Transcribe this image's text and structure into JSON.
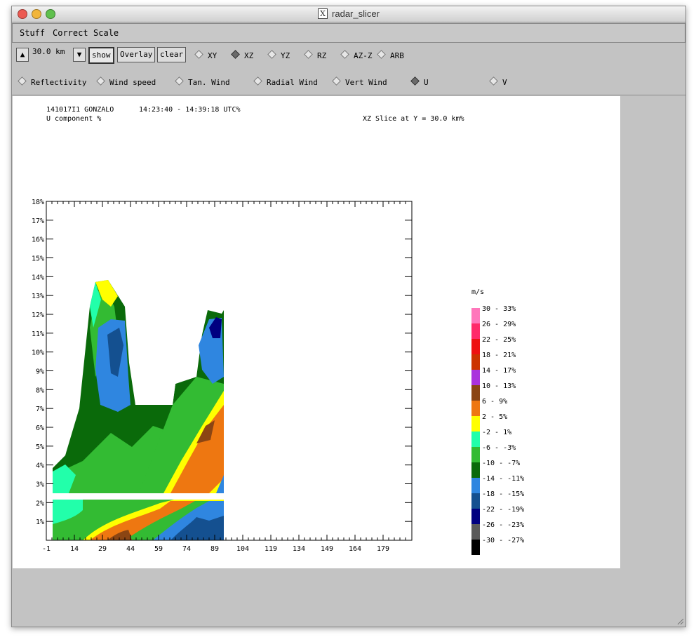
{
  "window": {
    "title": "radar_slicer"
  },
  "menu": [
    "Stuff",
    "Correct",
    "Scale"
  ],
  "toolbar": {
    "distance": "30.0 km",
    "show_label": "show",
    "overlay_label": "Overlay",
    "clear_label": "clear",
    "slice_options": [
      "XY",
      "XZ",
      "YZ",
      "RZ",
      "AZ-Z",
      "ARB"
    ],
    "selected_slice": "XZ"
  },
  "fields": {
    "options": [
      "Reflectivity",
      "Wind speed",
      "Tan. Wind",
      "Radial Wind",
      "Vert Wind",
      "U",
      "V"
    ],
    "selected": "U"
  },
  "plot": {
    "header_id": "141017I1 GONZALO",
    "header_time": "14:23:40 - 14:39:18 UTC%",
    "header_field": "U component %",
    "header_slice": "XZ Slice at Y = 30.0 km%",
    "x_ticks": [
      "-1",
      "14",
      "29",
      "44",
      "59",
      "74",
      "89",
      "104",
      "119",
      "134",
      "149",
      "164",
      "179"
    ],
    "y_ticks": [
      "1%",
      "2%",
      "3%",
      "4%",
      "5%",
      "6%",
      "7%",
      "8%",
      "9%",
      "10%",
      "11%",
      "12%",
      "13%",
      "14%",
      "15%",
      "16%",
      "17%",
      "18%"
    ],
    "legend_unit": "m/s",
    "legend": [
      {
        "label": "30 - 33%",
        "color": "#ff77bb"
      },
      {
        "label": "26 - 29%",
        "color": "#ff2a6a"
      },
      {
        "label": "22 - 25%",
        "color": "#ee1111"
      },
      {
        "label": "18 - 21%",
        "color": "#cc3300"
      },
      {
        "label": "14 - 17%",
        "color": "#aa33dd"
      },
      {
        "label": "10 - 13%",
        "color": "#8b4513"
      },
      {
        "label": "6 - 9%",
        "color": "#ee7711"
      },
      {
        "label": "2 - 5%",
        "color": "#ffff00"
      },
      {
        "label": "-2 - 1%",
        "color": "#22ffaa"
      },
      {
        "label": "-6 - -3%",
        "color": "#33bb33"
      },
      {
        "label": "-10 - -7%",
        "color": "#0a6a0a"
      },
      {
        "label": "-14 - -11%",
        "color": "#2f86e0"
      },
      {
        "label": "-18 - -15%",
        "color": "#145090"
      },
      {
        "label": "-22 - -19%",
        "color": "#000080"
      },
      {
        "label": "-26 - -23%",
        "color": "#5a5a5a"
      },
      {
        "label": "-30 - -27%",
        "color": "#000000"
      }
    ]
  }
}
